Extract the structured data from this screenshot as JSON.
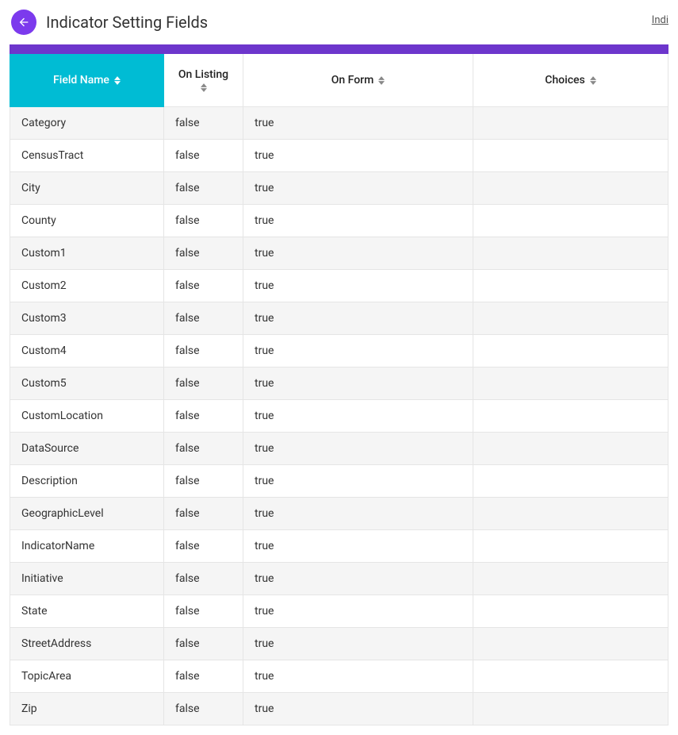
{
  "header": {
    "title": "Indicator Setting Fields",
    "link": "Indi"
  },
  "table": {
    "columns": {
      "fieldName": "Field Name",
      "onListing": "On Listing",
      "onForm": "On Form",
      "choices": "Choices"
    },
    "rows": [
      {
        "fieldName": "Category",
        "onListing": "false",
        "onForm": "true",
        "choices": ""
      },
      {
        "fieldName": "CensusTract",
        "onListing": "false",
        "onForm": "true",
        "choices": ""
      },
      {
        "fieldName": "City",
        "onListing": "false",
        "onForm": "true",
        "choices": ""
      },
      {
        "fieldName": "County",
        "onListing": "false",
        "onForm": "true",
        "choices": ""
      },
      {
        "fieldName": "Custom1",
        "onListing": "false",
        "onForm": "true",
        "choices": ""
      },
      {
        "fieldName": "Custom2",
        "onListing": "false",
        "onForm": "true",
        "choices": ""
      },
      {
        "fieldName": "Custom3",
        "onListing": "false",
        "onForm": "true",
        "choices": ""
      },
      {
        "fieldName": "Custom4",
        "onListing": "false",
        "onForm": "true",
        "choices": ""
      },
      {
        "fieldName": "Custom5",
        "onListing": "false",
        "onForm": "true",
        "choices": ""
      },
      {
        "fieldName": "CustomLocation",
        "onListing": "false",
        "onForm": "true",
        "choices": ""
      },
      {
        "fieldName": "DataSource",
        "onListing": "false",
        "onForm": "true",
        "choices": ""
      },
      {
        "fieldName": "Description",
        "onListing": "false",
        "onForm": "true",
        "choices": ""
      },
      {
        "fieldName": "GeographicLevel",
        "onListing": "false",
        "onForm": "true",
        "choices": ""
      },
      {
        "fieldName": "IndicatorName",
        "onListing": "false",
        "onForm": "true",
        "choices": ""
      },
      {
        "fieldName": "Initiative",
        "onListing": "false",
        "onForm": "true",
        "choices": ""
      },
      {
        "fieldName": "State",
        "onListing": "false",
        "onForm": "true",
        "choices": ""
      },
      {
        "fieldName": "StreetAddress",
        "onListing": "false",
        "onForm": "true",
        "choices": ""
      },
      {
        "fieldName": "TopicArea",
        "onListing": "false",
        "onForm": "true",
        "choices": ""
      },
      {
        "fieldName": "Zip",
        "onListing": "false",
        "onForm": "true",
        "choices": ""
      }
    ]
  }
}
